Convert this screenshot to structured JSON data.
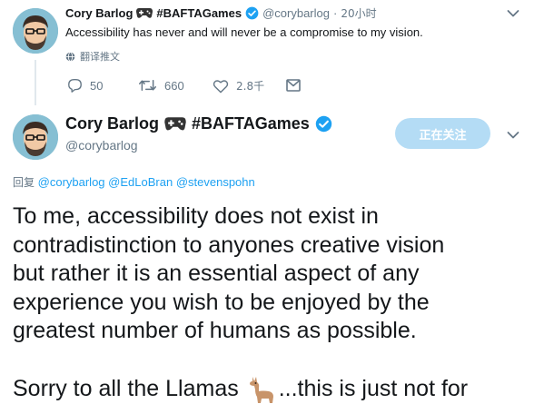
{
  "tweet1": {
    "name": "Cory Barlog",
    "hashtag": "#BAFTAGames",
    "handle": "@corybarlog",
    "separator": "·",
    "time": "20小时",
    "text": "Accessibility has never and will never be a compromise to my vision.",
    "translate_label": "翻译推文",
    "actions": {
      "replies": "50",
      "retweets": "660",
      "likes": "2.8千"
    }
  },
  "tweet2": {
    "name": "Cory Barlog",
    "hashtag": "#BAFTAGames",
    "handle": "@corybarlog",
    "follow_label": "正在关注",
    "reply_prefix": "回复",
    "reply_to": [
      "@corybarlog",
      "@EdLoBran",
      "@stevenspohn"
    ],
    "body_lines": [
      "To me, accessibility does not exist in",
      "contradistinction to anyones creative vision",
      "but rather it is an essential aspect of any",
      "experience you wish to be enjoyed by the",
      "greatest number of humans as possible."
    ],
    "sorry_before": "Sorry to all the Llamas",
    "sorry_after": "...this is just not for"
  },
  "colors": {
    "accent": "#1da1f2",
    "muted": "#657786",
    "follow_button": "#b4dcf5",
    "text": "#14171a"
  },
  "icons": [
    "gamepad-icon",
    "verified-badge-icon",
    "chevron-down-icon",
    "globe-icon",
    "reply-icon",
    "retweet-icon",
    "like-icon",
    "dm-icon",
    "llama-emoji"
  ]
}
